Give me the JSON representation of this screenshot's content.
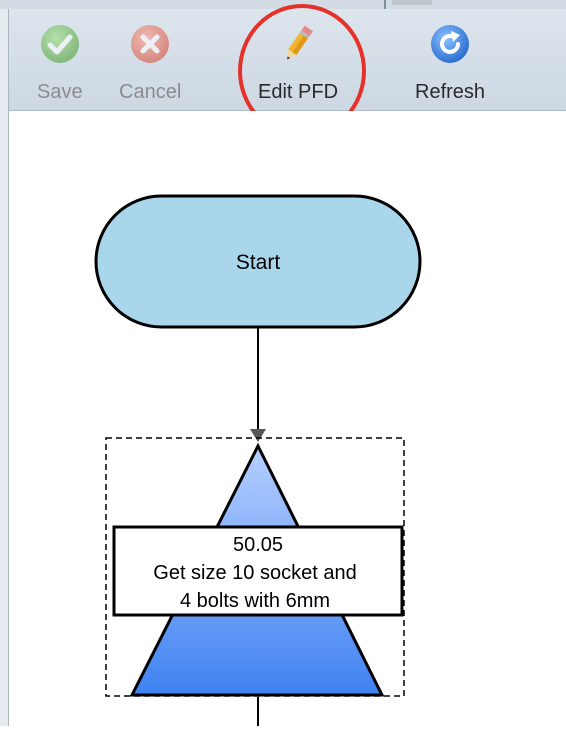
{
  "toolbar": {
    "save_label": "Save",
    "cancel_label": "Cancel",
    "edit_pfd_label": "Edit PFD",
    "refresh_label": "Refresh",
    "icons": {
      "save": "check-icon",
      "cancel": "x-icon",
      "edit_pfd": "pencil-icon",
      "refresh": "refresh-icon"
    },
    "highlighted_item": "Edit PFD"
  },
  "flowchart": {
    "start_label": "Start",
    "operation": {
      "number": "50.05",
      "line1": "Get size 10 socket and",
      "line2": "4 bolts with 6mm"
    }
  },
  "colors": {
    "terminal_fill": "#a9d6ea",
    "triangle_top": "#b6cfff",
    "triangle_bottom": "#3f82f2",
    "highlight_ring": "#e5312a"
  }
}
